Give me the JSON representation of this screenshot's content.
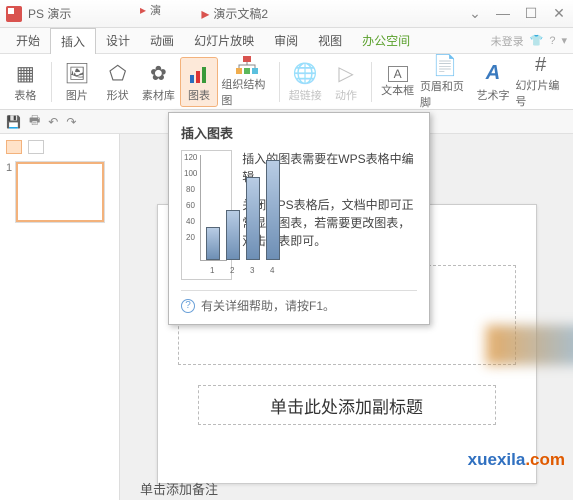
{
  "titlebar": {
    "app_name": "PS 演示",
    "doc_title": "演示文稿2"
  },
  "menu": {
    "tabs": [
      "开始",
      "插入",
      "设计",
      "动画",
      "幻灯片放映",
      "审阅",
      "视图"
    ],
    "office_space": "办公空间",
    "not_logged": "未登录"
  },
  "ribbon": {
    "table": "表格",
    "picture": "图片",
    "shape": "形状",
    "material": "素材库",
    "chart": "图表",
    "orgchart": "组织结构图",
    "hyperlink": "超链接",
    "action": "动作",
    "textbox": "文本框",
    "headerfooter": "页眉和页脚",
    "wordart": "艺术字",
    "slidenum": "幻灯片编号"
  },
  "doc_tab": "演",
  "tooltip": {
    "title": "插入图表",
    "p1": "插入的图表需要在WPS表格中编辑。",
    "p2": "关闭WPS表格后，文档中即可正常显示图表，若需要更改图表，双击图表即可。",
    "help": "有关详细帮助，请按F1。"
  },
  "chart_data": {
    "type": "bar",
    "categories": [
      "1",
      "2",
      "3",
      "4"
    ],
    "values": [
      40,
      60,
      100,
      120
    ],
    "ylim": [
      0,
      120
    ],
    "ticks": [
      20,
      40,
      60,
      80,
      100,
      120
    ]
  },
  "slide": {
    "subtitle": "单击此处添加副标题",
    "notes": "单击添加备注"
  },
  "thumb": {
    "num": "1"
  },
  "watermark": {
    "a": "xuexila",
    "b": ".com"
  }
}
